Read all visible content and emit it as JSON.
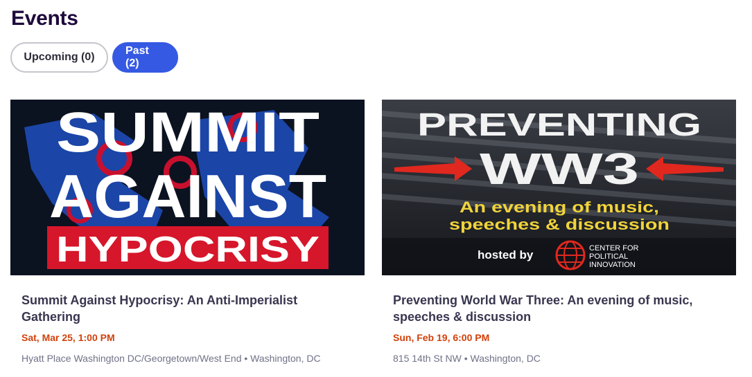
{
  "page": {
    "title": "Events"
  },
  "tabs": [
    {
      "label": "Upcoming (0)",
      "active": false
    },
    {
      "label": "Past (2)",
      "active": true
    }
  ],
  "colors": {
    "accent": "#3659e3",
    "date": "#d1410c",
    "title": "#1e0a3c"
  },
  "events": [
    {
      "banner": {
        "line1": "SUMMIT",
        "line2": "AGAINST",
        "line3": "HYPOCRISY"
      },
      "title": "Summit Against Hypocrisy: An Anti-Imperialist Gathering",
      "date": "Sat, Mar 25, 1:00 PM",
      "location": "Hyatt Place Washington DC/Georgetown/West End • Washington, DC"
    },
    {
      "banner": {
        "line1": "PREVENTING",
        "line2": "WW3",
        "line3": "An evening of music,",
        "line4": "speeches & discussion",
        "hosted": "hosted by",
        "org1": "CENTER FOR",
        "org2": "POLITICAL",
        "org3": "INNOVATION"
      },
      "title": "Preventing World War Three: An evening of music, speeches & discussion",
      "date": "Sun, Feb 19, 6:00 PM",
      "location": "815 14th St NW • Washington, DC"
    }
  ]
}
